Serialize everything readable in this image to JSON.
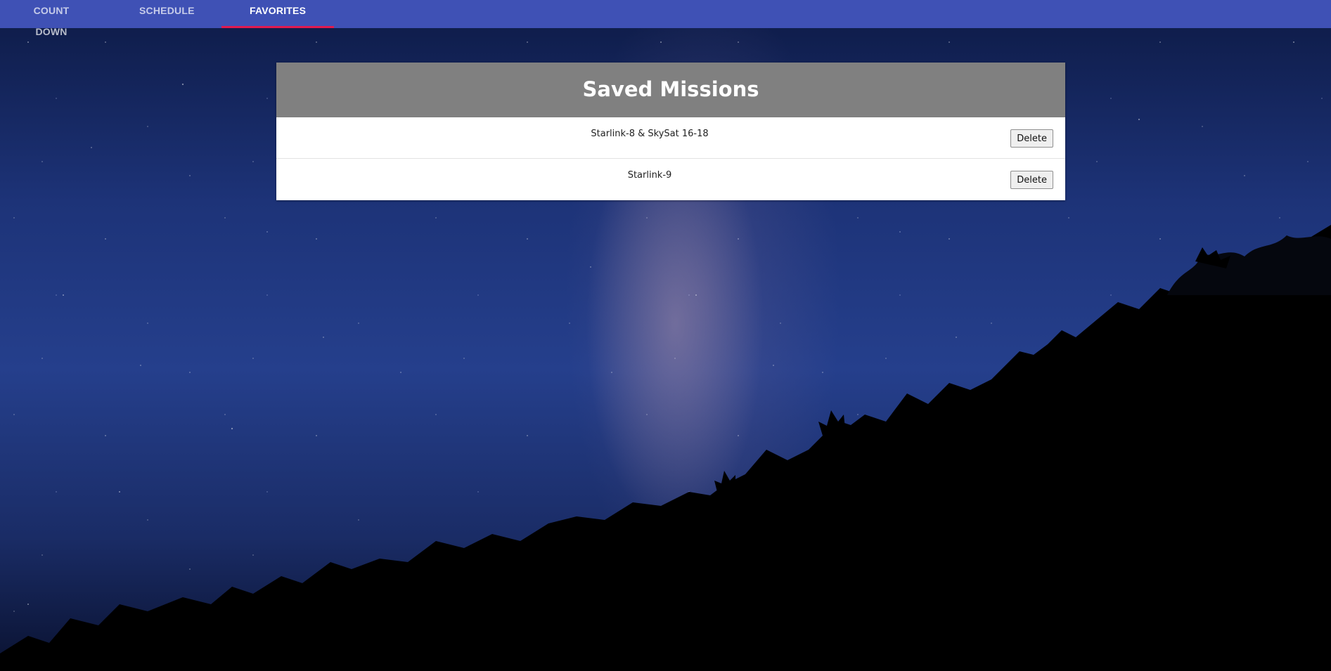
{
  "nav": {
    "tabs": [
      {
        "label": "COUNT DOWN",
        "active": false
      },
      {
        "label": "SCHEDULE",
        "active": false
      },
      {
        "label": "FAVORITES",
        "active": true
      }
    ],
    "accent_color": "#e01a4f",
    "bar_color": "#3f51b5"
  },
  "saved": {
    "title": "Saved Missions",
    "header_color": "#808080",
    "missions": [
      {
        "name": "Starlink-8 & SkySat 16-18",
        "delete_label": "Delete"
      },
      {
        "name": "Starlink-9",
        "delete_label": "Delete"
      }
    ]
  }
}
